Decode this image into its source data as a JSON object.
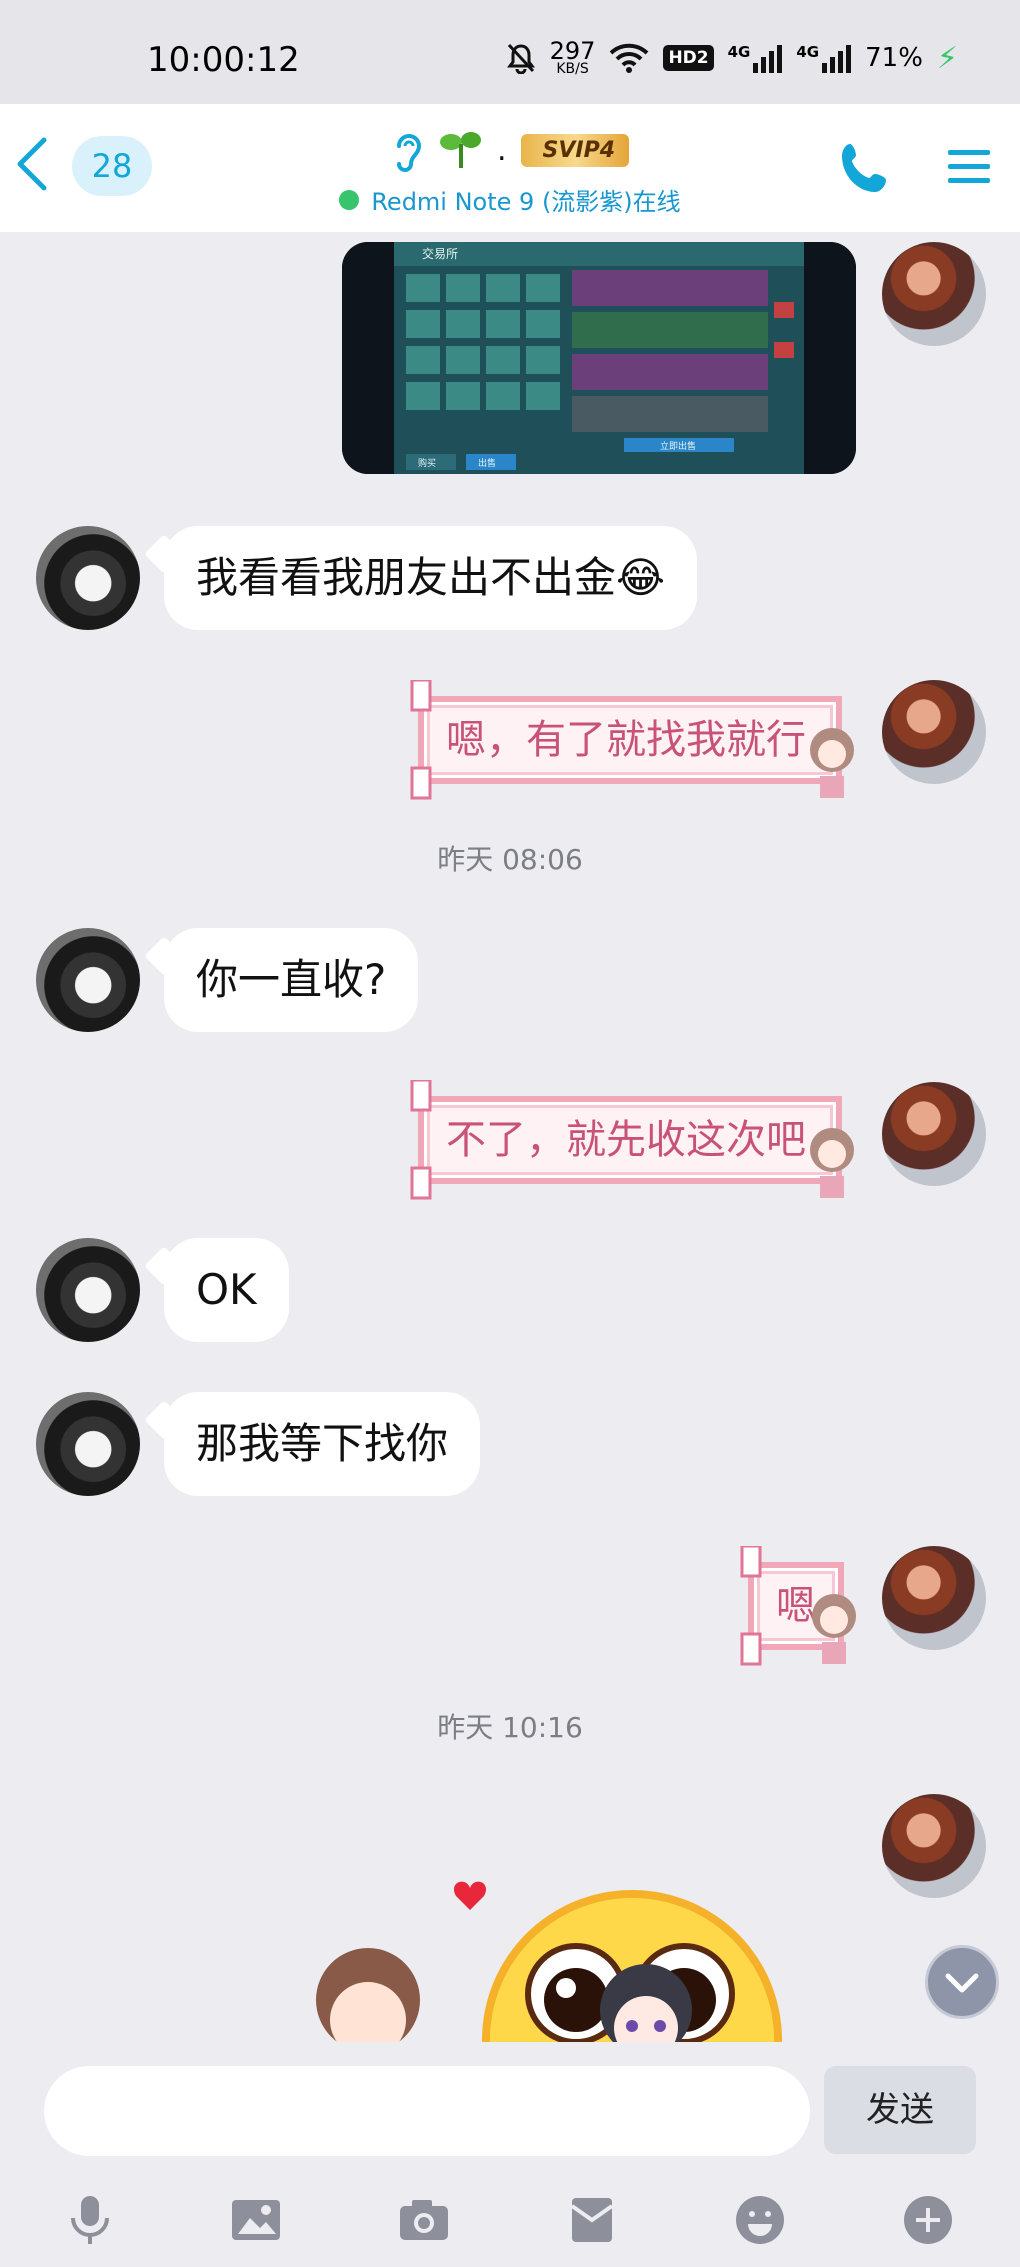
{
  "status_bar": {
    "time": "10:00:12",
    "net_speed": "297",
    "net_speed_unit": "KB/S",
    "hd_badge": "HD2",
    "sim1": "4G",
    "sim2": "4G",
    "battery": "71%"
  },
  "header": {
    "unread_count": "28",
    "svip_badge": "SVIP4",
    "name_separator": ".",
    "device_status": "Redmi Note 9 (流影紫)在线",
    "online_color": "#36c56b",
    "accent": "#12a7d8"
  },
  "image_card": {
    "panel_title": "交易所",
    "buy_label": "购买",
    "sell_label": "出售",
    "confirm_label": "立即出售"
  },
  "messages": [
    {
      "side": "peer",
      "text": "我看看我朋友出不出金😂"
    },
    {
      "side": "me",
      "text": "嗯，有了就找我就行",
      "style": "pink"
    },
    {
      "side": "timestamp",
      "text": "昨天 08:06"
    },
    {
      "side": "peer",
      "text": "你一直收?"
    },
    {
      "side": "me",
      "text": "不了，就先收这次吧",
      "style": "pink"
    },
    {
      "side": "peer",
      "text": "OK"
    },
    {
      "side": "peer",
      "text": "那我等下找你"
    },
    {
      "side": "me",
      "text": "嗯",
      "style": "pink"
    },
    {
      "side": "timestamp",
      "text": "昨天 10:16"
    }
  ],
  "composer": {
    "input_value": "",
    "send_label": "发送"
  },
  "toolbar_icons": [
    "microphone-icon",
    "image-icon",
    "camera-icon",
    "red-packet-icon",
    "emoji-icon",
    "plus-icon"
  ]
}
